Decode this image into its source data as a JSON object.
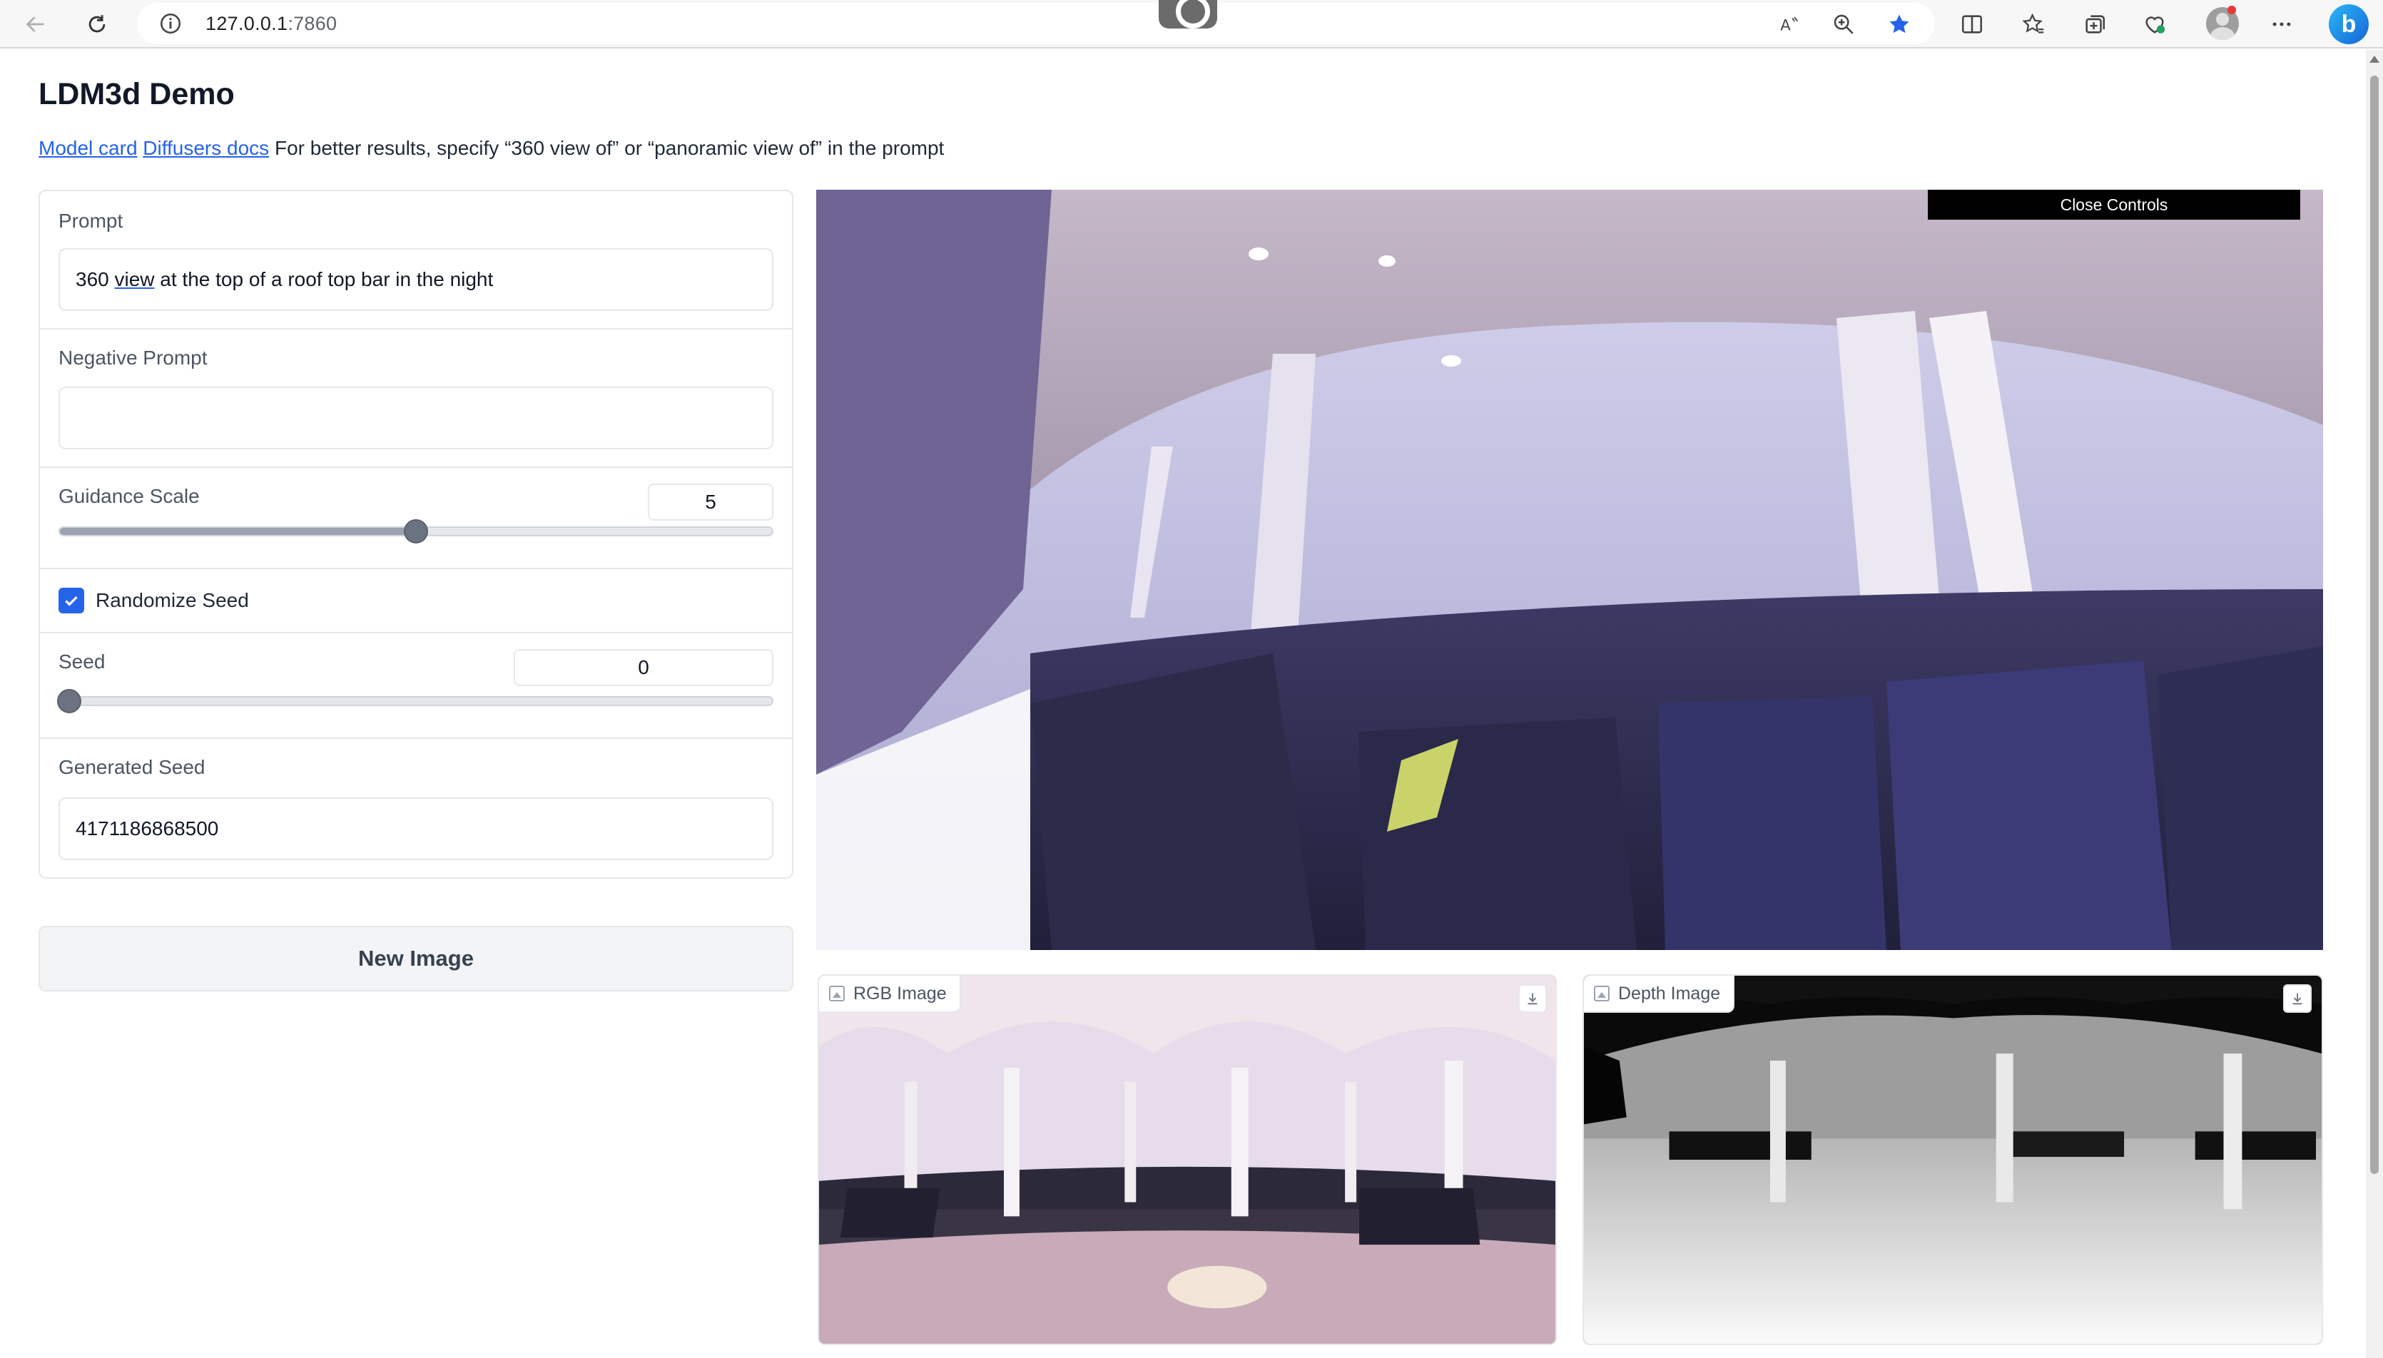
{
  "browser": {
    "url_host": "127.0.0.1",
    "url_port": ":7860"
  },
  "page": {
    "title": "LDM3d Demo",
    "links": {
      "model_card": "Model card",
      "diffusers_docs": "Diffusers docs"
    },
    "hint": "For better results, specify “360 view of” or “panoramic view of” in the prompt"
  },
  "form": {
    "prompt": {
      "label": "Prompt",
      "value_start": "360 ",
      "value_underlined": "view",
      "value_end": " at the top of a roof top bar in the night"
    },
    "negative_prompt": {
      "label": "Negative Prompt",
      "value": ""
    },
    "guidance_scale": {
      "label": "Guidance Scale",
      "value": "5",
      "fraction": 0.5
    },
    "randomize_seed": {
      "label": "Randomize Seed",
      "checked": true
    },
    "seed": {
      "label": "Seed",
      "value": "0",
      "fraction": 0.0
    },
    "generated_seed": {
      "label": "Generated Seed",
      "value": "4171186868500"
    },
    "new_image_button": "New Image"
  },
  "viewer": {
    "close_controls": "Close Controls"
  },
  "outputs": {
    "rgb_label": "RGB Image",
    "depth_label": "Depth Image"
  },
  "colors": {
    "accent": "#2563eb",
    "slider_knob": "#6b7280",
    "favorite_star": "#2563eb"
  }
}
